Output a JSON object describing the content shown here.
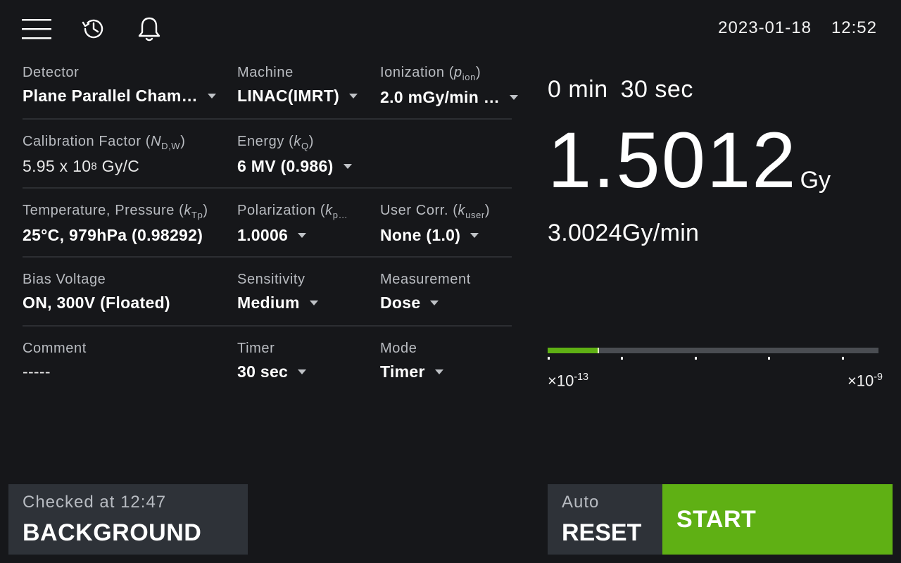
{
  "header": {
    "menu_icon": "hamburger-menu-icon",
    "history_icon": "history-clock-icon",
    "bell_icon": "bell-icon",
    "date": "2023-01-18",
    "time": "12:52"
  },
  "settings": {
    "detector": {
      "label": "Detector",
      "value": "Plane Parallel Cham…"
    },
    "machine": {
      "label": "Machine",
      "value": "LINAC(IMRT)"
    },
    "ionization": {
      "label_main": "Ionization (",
      "label_sym": "p",
      "label_sub": "ion",
      "label_end": ")",
      "value": "2.0 mGy/min …"
    },
    "calibration": {
      "label_main": "Calibration Factor (",
      "label_sym": "N",
      "label_sub": "D,W",
      "label_end": ")",
      "value_main": "5.95 x 10",
      "value_exp": "8",
      "value_unit": " Gy/C"
    },
    "energy": {
      "label_main": "Energy (",
      "label_sym": "k",
      "label_sub": "Q",
      "label_end": ")",
      "value": "6 MV (0.986)"
    },
    "temperature": {
      "label_main": "Temperature, Pressure (",
      "label_sym": "k",
      "label_sub": "Tp",
      "label_end": ")",
      "value": "25°C, 979hPa (0.98292)"
    },
    "polarization": {
      "label_main": "Polarization (",
      "label_sym": "k",
      "label_sub": "p…",
      "value": "1.0006"
    },
    "user_corr": {
      "label_main": "User Corr. (",
      "label_sym": "k",
      "label_sub": "user",
      "label_end": ")",
      "value": "None (1.0)"
    },
    "bias": {
      "label": "Bias Voltage",
      "value": "ON, 300V (Floated)"
    },
    "sensitivity": {
      "label": "Sensitivity",
      "value": "Medium"
    },
    "measurement": {
      "label": "Measurement",
      "value": "Dose"
    },
    "comment": {
      "label": "Comment",
      "value": "-----"
    },
    "timer": {
      "label": "Timer",
      "value": "30 sec"
    },
    "mode": {
      "label": "Mode",
      "value": "Timer"
    }
  },
  "readout": {
    "timer_min": "0 min",
    "timer_sec": "30 sec",
    "dose_value": "1.5012",
    "dose_unit": "Gy",
    "rate": "3.0024Gy/min"
  },
  "range_bar": {
    "fill_fraction": 0.15,
    "accent": "#5fb014",
    "low_base": "×10",
    "low_exp": "-13",
    "high_base": "×10",
    "high_exp": "-9"
  },
  "buttons": {
    "background_sub": "Checked at 12:47",
    "background_main": "BACKGROUND",
    "reset_sub": "Auto",
    "reset_main": "RESET",
    "start_main": "START"
  },
  "colors": {
    "background": "#16171a",
    "panel": "#2e3238",
    "start": "#5fb014"
  }
}
